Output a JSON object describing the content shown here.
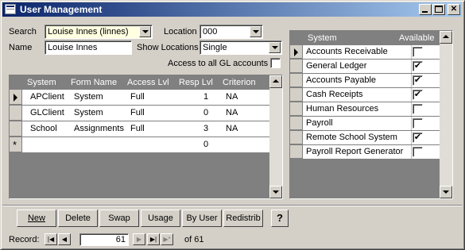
{
  "window": {
    "title": "User Management"
  },
  "filters": {
    "search_label": "Search",
    "search_value": "Louise Innes (linnes)",
    "location_label": "Location",
    "location_value": "000",
    "name_label": "Name",
    "name_value": "Louise Innes",
    "show_locations_label": "Show Locations",
    "show_locations_value": "Single",
    "gl_access_label": "Access to all GL accounts",
    "gl_access_checked": false
  },
  "forms_table": {
    "columns": [
      "System",
      "Form Name",
      "Access Lvl",
      "Resp Lvl",
      "Criterion"
    ],
    "rows": [
      {
        "system": "APClient",
        "form": "System",
        "access": "Full",
        "resp": "1",
        "criterion": "NA",
        "current": true
      },
      {
        "system": "GLClient",
        "form": "System",
        "access": "Full",
        "resp": "0",
        "criterion": "NA",
        "current": false
      },
      {
        "system": "School",
        "form": "Assignments",
        "access": "Full",
        "resp": "3",
        "criterion": "NA",
        "current": false
      }
    ],
    "new_row_marker": "*",
    "new_row_resp": "0"
  },
  "systems_table": {
    "columns": [
      "System",
      "Available"
    ],
    "rows": [
      {
        "name": "Accounts Receivable",
        "available": false,
        "current": true
      },
      {
        "name": "General Ledger",
        "available": true,
        "current": false
      },
      {
        "name": "Accounts Payable",
        "available": true,
        "current": false
      },
      {
        "name": "Cash Receipts",
        "available": true,
        "current": false
      },
      {
        "name": "Human Resources",
        "available": false,
        "current": false
      },
      {
        "name": "Payroll",
        "available": false,
        "current": false
      },
      {
        "name": "Remote School System",
        "available": true,
        "current": false
      },
      {
        "name": "Payroll Report Generator",
        "available": false,
        "current": false
      }
    ]
  },
  "buttons": {
    "new": "New",
    "delete": "Delete",
    "swap": "Swap",
    "usage": "Usage",
    "by_user": "By User",
    "redistrib": "Redistrib",
    "help": "?"
  },
  "record_nav": {
    "label": "Record:",
    "current": "61",
    "of_label": "of 61"
  },
  "colors": {
    "title_start": "#0a246a",
    "title_end": "#a6caf0",
    "face": "#d4d0c8",
    "shadow": "#808080"
  }
}
